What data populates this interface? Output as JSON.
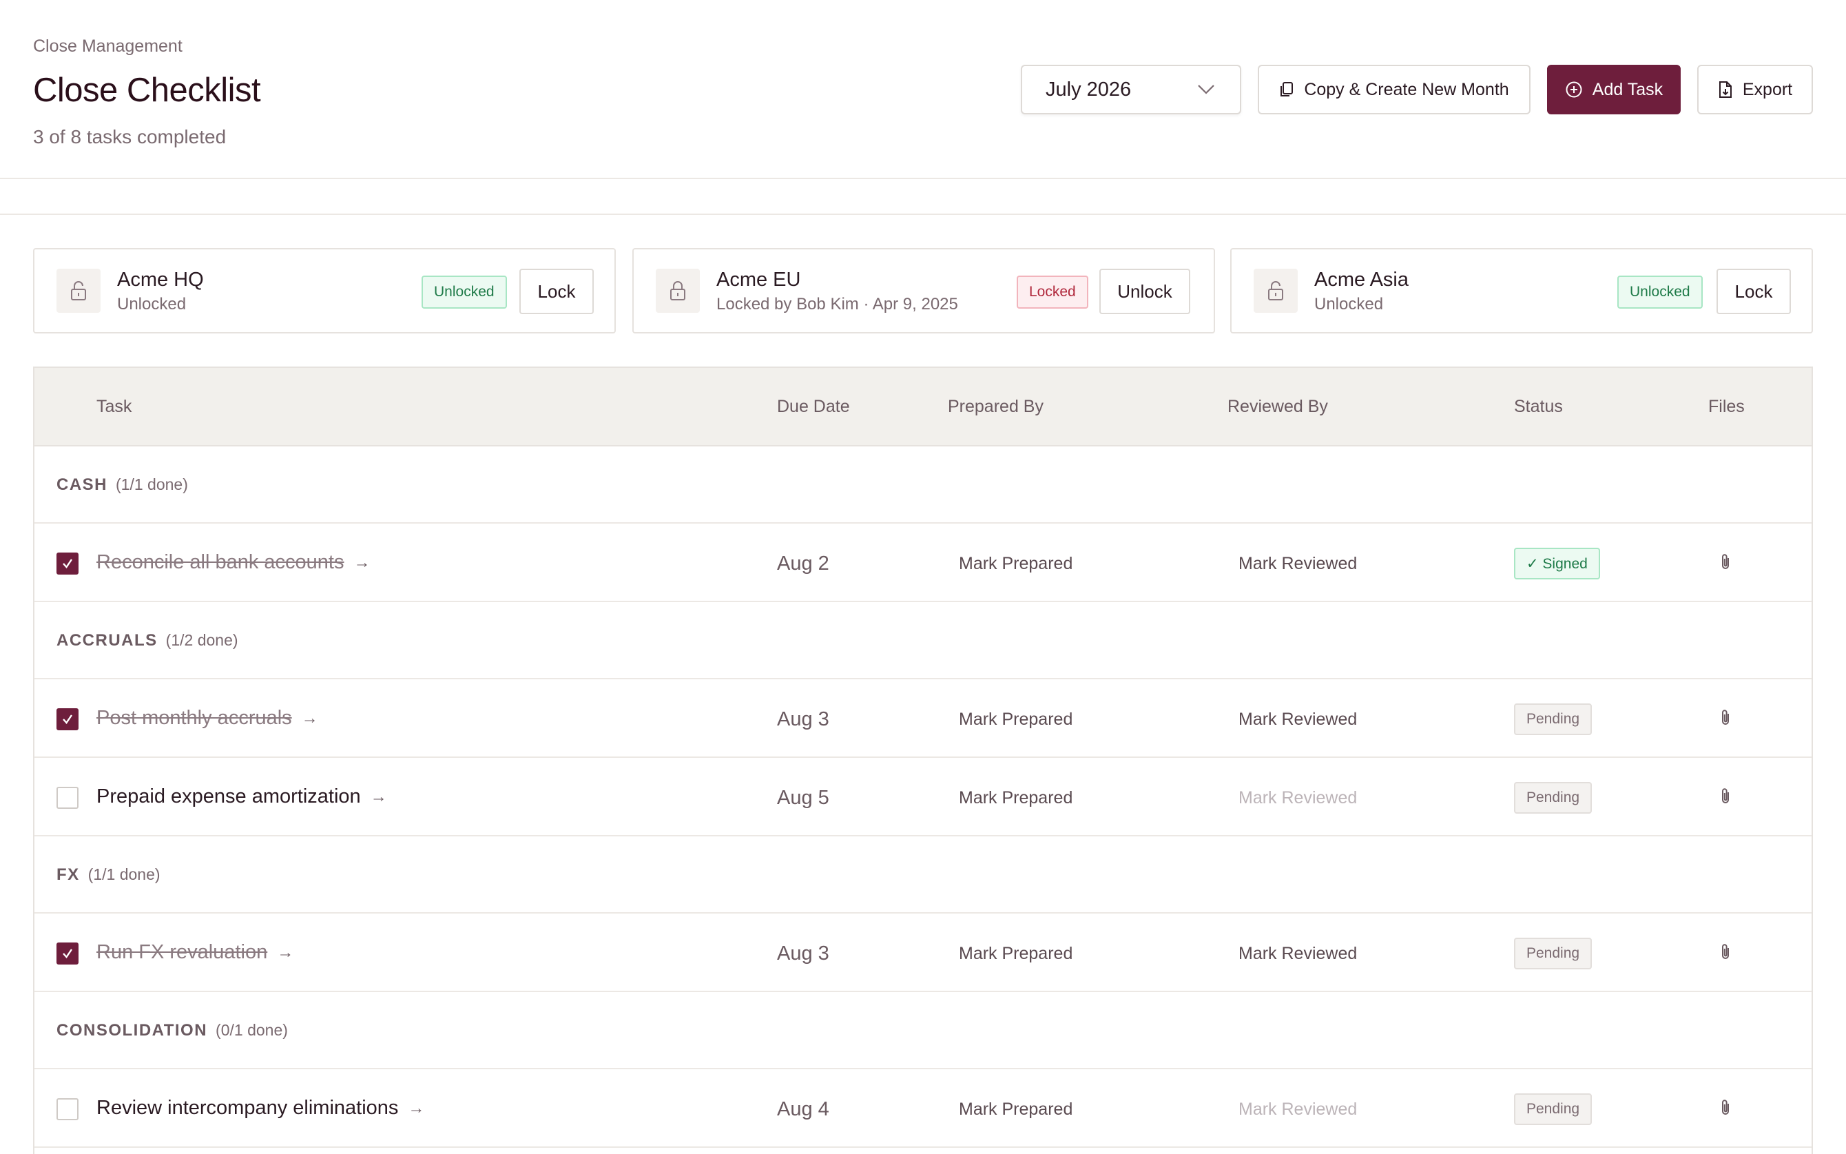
{
  "header": {
    "breadcrumb": "Close Management",
    "title": "Close Checklist",
    "subtitle": "3 of 8 tasks completed"
  },
  "toolbar": {
    "month": "July 2026",
    "copy_label": "Copy & Create New Month",
    "add_label": "Add Task",
    "export_label": "Export"
  },
  "entities": [
    {
      "name": "Acme HQ",
      "sub": "Unlocked",
      "badge": "Unlocked",
      "action": "Lock"
    },
    {
      "name": "Acme EU",
      "sub": "Locked by Bob Kim · Apr 9, 2025",
      "badge": "Locked",
      "action": "Unlock"
    },
    {
      "name": "Acme Asia",
      "sub": "Unlocked",
      "badge": "Unlocked",
      "action": "Lock"
    }
  ],
  "table": {
    "columns": [
      "Task",
      "Due Date",
      "Prepared By",
      "Reviewed By",
      "Status",
      "Files"
    ],
    "groups": [
      {
        "name": "CASH",
        "count": "(1/1 done)"
      },
      {
        "name": "ACCRUALS",
        "count": "(1/2 done)"
      },
      {
        "name": "FX",
        "count": "(1/1 done)"
      },
      {
        "name": "CONSOLIDATION",
        "count": "(0/1 done)"
      }
    ],
    "rows": [
      {
        "task": "Reconcile all bank accounts",
        "arrow": "→",
        "due": "Aug 2",
        "prepared": "Mark Prepared",
        "reviewed": "Mark Reviewed",
        "status": "✓ Signed",
        "done": true
      },
      {
        "task": "Post monthly accruals",
        "arrow": "→",
        "due": "Aug 3",
        "prepared": "Mark Prepared",
        "reviewed": "Mark Reviewed",
        "status": "Pending",
        "done": true
      },
      {
        "task": "Prepaid expense amortization",
        "arrow": "→",
        "due": "Aug 5",
        "prepared": "Mark Prepared",
        "reviewed": "Mark Reviewed",
        "status": "Pending",
        "done": false
      },
      {
        "task": "Run FX revaluation",
        "arrow": "→",
        "due": "Aug 3",
        "prepared": "Mark Prepared",
        "reviewed": "Mark Reviewed",
        "status": "Pending",
        "done": true
      },
      {
        "task": "Review intercompany eliminations",
        "arrow": "→",
        "due": "Aug 4",
        "prepared": "Mark Prepared",
        "reviewed": "Mark Reviewed",
        "status": "Pending",
        "done": false
      }
    ]
  },
  "colors": {
    "accent": "#6e1e3c",
    "signed_bg": "#ecfaf2",
    "locked_text": "#b0283c"
  }
}
